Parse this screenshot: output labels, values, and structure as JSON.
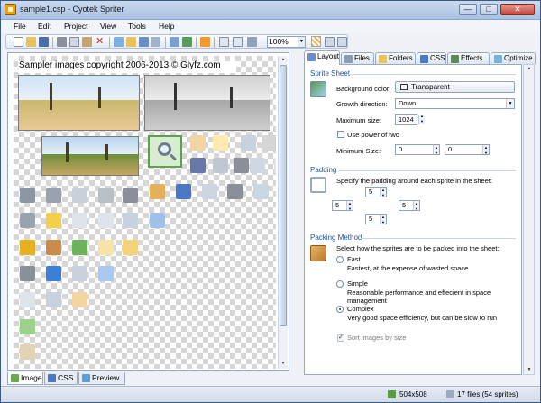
{
  "window": {
    "title": "sample1.csp - Cyotek Spriter",
    "controls": [
      "—",
      "□",
      "✕"
    ]
  },
  "menu": [
    "File",
    "Edit",
    "Project",
    "View",
    "Tools",
    "Help"
  ],
  "toolbar": {
    "zoom": "100%",
    "icons": [
      "new-icon",
      "open-icon",
      "save-icon",
      "cut-icon",
      "copy-icon",
      "paste-icon",
      "delete-icon",
      "add-image-icon",
      "add-folder-icon",
      "export-icon",
      "import-icon",
      "arrange-icon",
      "refresh-icon",
      "rss-icon",
      "preview-icon",
      "settings-icon",
      "background-grid-icon"
    ]
  },
  "canvas": {
    "copyright": "Sampler images copyright 2006-2013 © Glyfz.com"
  },
  "bottom_tabs": [
    "Image",
    "CSS",
    "Preview"
  ],
  "panel": {
    "tabs": [
      "Layout",
      "Files",
      "Folders",
      "CSS",
      "Effects",
      "Optimize"
    ],
    "active_tab": "Layout",
    "sprite_sheet": {
      "title": "Sprite Sheet",
      "background_label": "Background color:",
      "background_value": "Transparent",
      "growth_label": "Growth direction:",
      "growth_value": "Down",
      "max_size_label": "Maximum size:",
      "max_size_value": "1024",
      "power_of_two": "Use power of two",
      "min_size_label": "Minimum Size:",
      "min_w": "0",
      "min_h": "0"
    },
    "padding": {
      "title": "Padding",
      "description": "Specify the padding around each sprite in the sheet:",
      "top": "5",
      "left": "5",
      "right": "5",
      "bottom": "5"
    },
    "packing": {
      "title": "Packing Method",
      "description": "Select how the sprites are to be packed into the sheet:",
      "options": [
        {
          "label": "Fast",
          "desc": "Fastest, at the expense of wasted space",
          "selected": false
        },
        {
          "label": "Simple",
          "desc": "Reasonable performance and effecient in space management",
          "selected": false
        },
        {
          "label": "Complex",
          "desc": "Very good space efficiency, but can be slow to run",
          "selected": true
        }
      ],
      "sort_label": "Sort images by size"
    }
  },
  "status": {
    "dimensions": "504x508",
    "files": "17 files (54 sprites)"
  },
  "colors": {
    "section_title": "#1f4f9a",
    "title_bar": "#a9c1e2",
    "window_bg": "#eef1f6"
  }
}
